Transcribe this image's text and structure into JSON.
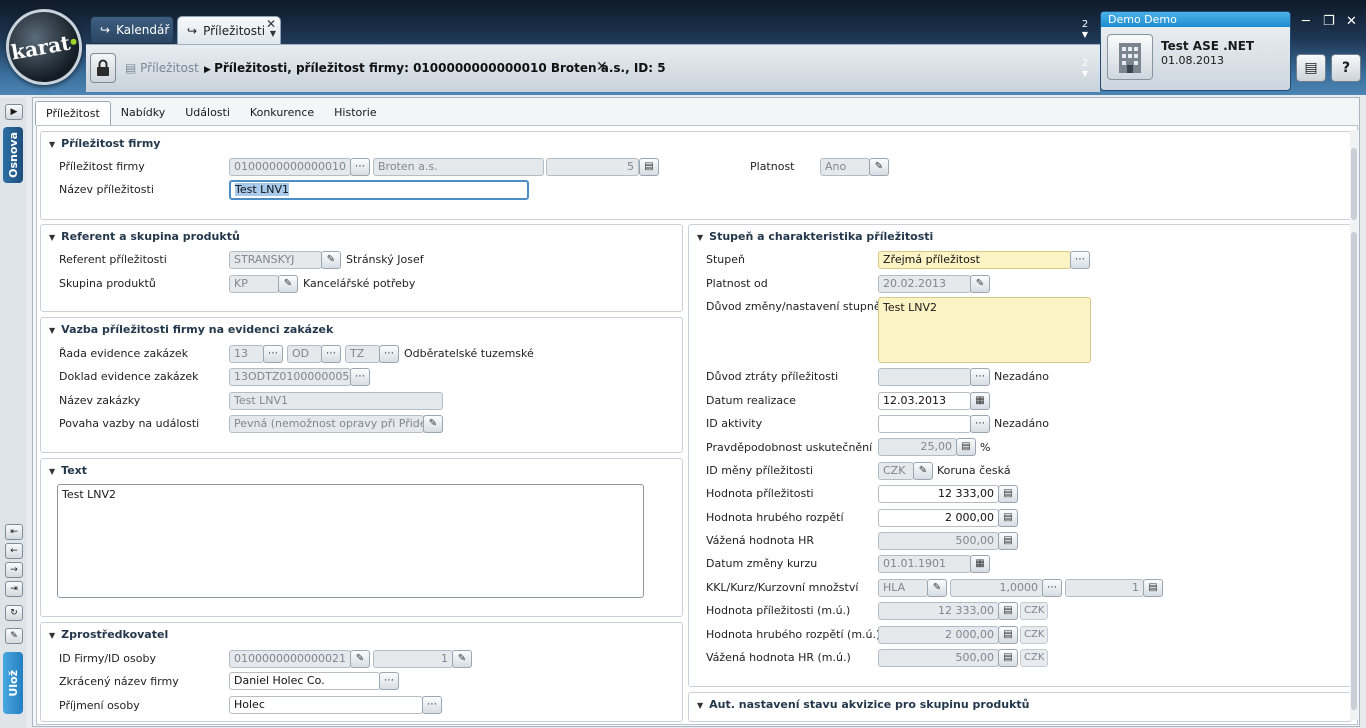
{
  "app": {
    "logo": "karat"
  },
  "tabs": [
    {
      "label": "Kalendář"
    },
    {
      "label": "Příležitosti"
    }
  ],
  "counters": {
    "top": "2",
    "bottom": "2"
  },
  "breadcrumb": {
    "root": "Příležitost",
    "current": "Příležitosti, příležitost firmy: 0100000000000010 Broten a.s., ID: 5"
  },
  "user": {
    "header": "Demo Demo",
    "company": "Test ASE .NET",
    "date": "01.08.2013"
  },
  "left_tabs": {
    "outline": "Osnova",
    "save": "Ulož"
  },
  "subtabs": [
    "Příležitost",
    "Nabídky",
    "Události",
    "Konkurence",
    "Historie"
  ],
  "sections": {
    "firm": {
      "title": "Příležitost firmy",
      "label_opp": "Příležitost firmy",
      "opp_id": "0100000000000010",
      "firm_name": "Broten a.s.",
      "opp_num": "5",
      "label_valid": "Platnost",
      "valid": "Ano",
      "label_name": "Název příležitosti",
      "name": "Test LNV1"
    },
    "referent": {
      "title": "Referent a skupina produktů",
      "label_ref": "Referent příležitosti",
      "ref_code": "STRANSKYJ",
      "ref_name": "Stránský Josef",
      "label_group": "Skupina produktů",
      "group_code": "KP",
      "group_name": "Kancelářské potřeby"
    },
    "link": {
      "title": "Vazba příležitosti firmy na evidenci zakázek",
      "label_series": "Řada evidence zakázek",
      "series1": "13",
      "series2": "OD",
      "series3": "TZ",
      "series_name": "Odběratelské tuzemské",
      "label_doc": "Doklad evidence zakázek",
      "doc": "13ODTZ0100000005",
      "label_order": "Název zakázky",
      "order": "Test LNV1",
      "label_nature": "Povaha vazby na události",
      "nature": "Pevná (nemožnost opravy při Přidej)"
    },
    "text": {
      "title": "Text",
      "value": "Test LNV2"
    },
    "broker": {
      "title": "Zprostředkovatel",
      "label_id": "ID Firmy/ID osoby",
      "firm_id": "0100000000000021",
      "person_id": "1",
      "label_short": "Zkrácený název firmy",
      "short": "Daniel Holec Co.",
      "label_surname": "Příjmení osoby",
      "surname": "Holec"
    },
    "stage": {
      "title": "Stupeň a charakteristika příležitosti",
      "label_stage": "Stupeň",
      "stage": "Zřejmá příležitost",
      "label_valid_from": "Platnost od",
      "valid_from": "20.02.2013",
      "label_reason": "Důvod změny/nastavení stupně",
      "reason": "Test LNV2",
      "label_loss": "Důvod ztráty příležitosti",
      "loss_text": "Nezadáno",
      "label_realize": "Datum realizace",
      "realize": "12.03.2013",
      "label_activity": "ID aktivity",
      "activity_text": "Nezadáno",
      "label_prob": "Pravděpodobnost uskutečnění",
      "prob": "25,00",
      "prob_unit": "%",
      "label_cur": "ID měny příležitosti",
      "cur_code": "CZK",
      "cur_name": "Koruna česká",
      "label_value": "Hodnota příležitosti",
      "value": "12 333,00",
      "label_gross": "Hodnota hrubého rozpětí",
      "gross": "2 000,00",
      "label_weighted": "Vážená hodnota HR",
      "weighted": "500,00",
      "label_rate_date": "Datum změny kurzu",
      "rate_date": "01.01.1901",
      "label_kkl": "KKL/Kurz/Kurzovní množství",
      "kkl": "HLA",
      "rate": "1,0000",
      "qty": "1",
      "label_value_mu": "Hodnota příležitosti (m.ú.)",
      "value_mu": "12 333,00",
      "label_gross_mu": "Hodnota hrubého rozpětí (m.ú.)",
      "gross_mu": "2 000,00",
      "label_weighted_mu": "Vážená hodnota HR (m.ú.)",
      "weighted_mu": "500,00",
      "cur_badge": "CZK"
    },
    "auto": {
      "title": "Aut. nastavení stavu akvizice pro skupinu produktů"
    }
  }
}
